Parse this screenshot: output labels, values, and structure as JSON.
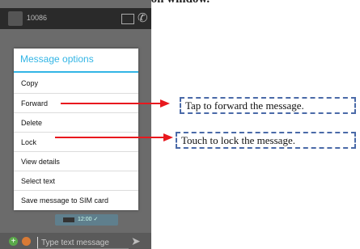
{
  "caption": "ssage in a message conversation window.",
  "phone": {
    "contact_number": "10086",
    "bubble_time": "12:00 ✓",
    "compose_placeholder": "Type text message"
  },
  "dialog": {
    "title": "Message options",
    "options": [
      "Copy",
      "Forward",
      "Delete",
      "Lock",
      "View details",
      "Select text",
      "Save message to SIM card"
    ]
  },
  "callouts": {
    "forward": "Tap to forward the message.",
    "lock": "Touch to lock the message."
  },
  "colors": {
    "accent": "#33b5e5",
    "arrow": "#e8181e",
    "callout_border": "#4a6aa8"
  }
}
